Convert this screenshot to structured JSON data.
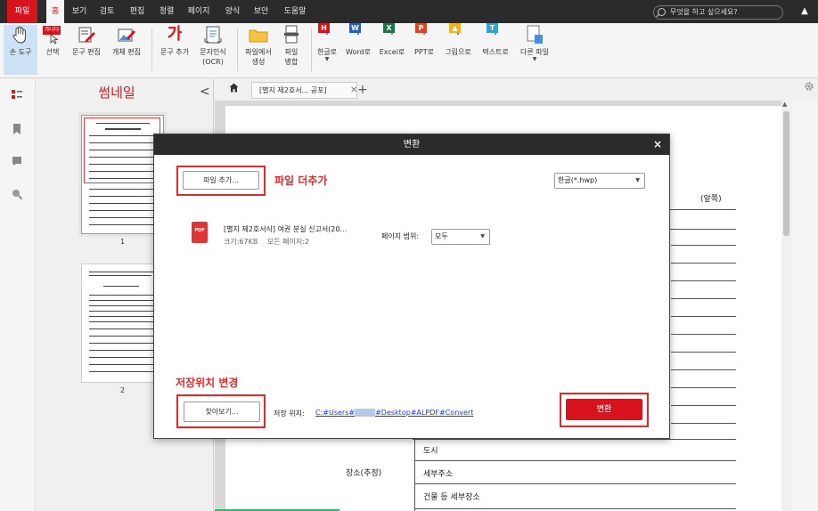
{
  "menubar": {
    "items": [
      "파일",
      "홈",
      "보기",
      "검토",
      "편집",
      "정렬",
      "페이지",
      "양식",
      "보안",
      "도움말"
    ],
    "search_placeholder": "무엇을 하고 싶으세요?",
    "collapse_glyph": "▲"
  },
  "ribbon": {
    "buttons": [
      {
        "label": "손 도구",
        "icon": "hand-icon"
      },
      {
        "label": "선택",
        "icon": "select-text-icon"
      },
      {
        "label": "문구 편집",
        "icon": "edit-text-icon"
      },
      {
        "label": "개체 편집",
        "icon": "edit-object-icon"
      },
      {
        "label": "문구 추가",
        "icon": "add-text-icon"
      },
      {
        "label": "문자인식",
        "label2": "(OCR)",
        "icon": "ocr-icon"
      },
      {
        "label": "파일에서",
        "label2": "생성",
        "icon": "folder-icon"
      },
      {
        "label": "파일",
        "label2": "병합",
        "icon": "merge-icon"
      },
      {
        "label": "한글로",
        "icon": "hwp-icon"
      },
      {
        "label": "Word로",
        "icon": "word-icon"
      },
      {
        "label": "Excel로",
        "icon": "excel-icon"
      },
      {
        "label": "PPT로",
        "icon": "ppt-icon"
      },
      {
        "label": "그림으로",
        "icon": "image-icon"
      },
      {
        "label": "텍스트로",
        "icon": "text-icon"
      },
      {
        "label": "다른 파일",
        "icon": "other-file-icon"
      }
    ],
    "select_badge": "가나다",
    "add_text_glyph": "가"
  },
  "thumbnails": {
    "title": "썸네일",
    "close_glyph": "<",
    "pages": [
      "1",
      "2"
    ]
  },
  "tabs": {
    "active_tab": "[별지 제2호서... 공포]",
    "close_glyph": "✕",
    "add_glyph": "+"
  },
  "document": {
    "label_right": "(앞쪽)",
    "place_label": "장소(추정)",
    "rows": [
      "도시",
      "세부주소",
      "건물 등 세부장소"
    ]
  },
  "dialog": {
    "title": "변환",
    "close_glyph": "×",
    "add_file_button": "파일 추가...",
    "add_file_annotation": "파일 더추가",
    "format_select": "한글(*.hwp)",
    "file": {
      "icon_text": "PDF",
      "name": "[별지 제2호서식] 여권 분실 신고서(20...",
      "size": "크기:67KB",
      "pages": "모든 페이지:2"
    },
    "page_range_label": "페이지 범위:",
    "page_range_value": "모두",
    "save_location_annotation": "저장위치 변경",
    "browse_button": "찾아보기...",
    "save_path_label": "저장 위치:",
    "save_path_prefix": "C:#Users#",
    "save_path_suffix": "#Desktop#ALPDF#Convert",
    "convert_button": "변환"
  },
  "colors": {
    "accent": "#d7141e",
    "annotation": "#e02a2a",
    "link": "#1a3fbf"
  }
}
